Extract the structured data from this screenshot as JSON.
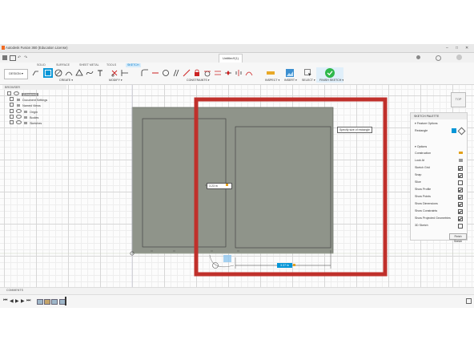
{
  "window": {
    "title": "Autodesk Fusion 360 (Education License)",
    "controls": [
      "–",
      "□",
      "✕"
    ]
  },
  "document": {
    "tab_title": "Untitled*(1)"
  },
  "toolbar": {
    "workspace_tabs": [
      "SOLID",
      "SURFACE",
      "SHEET METAL",
      "TOOLS",
      "SKETCH"
    ],
    "active_tab": "SKETCH",
    "design_label": "DESIGN ▾",
    "groups": [
      "CREATE ▾",
      "MODIFY ▾",
      "CONSTRAINTS ▾",
      "INSPECT ▾",
      "INSERT ▾",
      "SELECT ▾",
      "FINISH SKETCH ▾"
    ]
  },
  "browser": {
    "header": "BROWSER",
    "root": "(Unsaved)",
    "items": [
      "Document Settings",
      "Named Views",
      "Origin",
      "Bodies",
      "Sketches"
    ]
  },
  "canvas": {
    "tooltip": "Specify size of rectangle",
    "dimension_vertical": "3.23 in",
    "dimension_horizontal": "3.37 in",
    "view_cube_label": "TOP"
  },
  "sketch_palette": {
    "title": "SKETCH PALETTE",
    "feature_options_label": "Feature Options",
    "rectangle_label": "Rectangle",
    "options_label": "Options",
    "options": [
      {
        "label": "Construction",
        "checked": false
      },
      {
        "label": "Look At",
        "checked": false
      },
      {
        "label": "Sketch Grid",
        "checked": true
      },
      {
        "label": "Snap",
        "checked": true
      },
      {
        "label": "Slice",
        "checked": false
      },
      {
        "label": "Show Profile",
        "checked": true
      },
      {
        "label": "Show Points",
        "checked": true
      },
      {
        "label": "Show Dimensions",
        "checked": true
      },
      {
        "label": "Show Constraints",
        "checked": true
      },
      {
        "label": "Show Projected Geometries",
        "checked": true
      },
      {
        "label": "3D Sketch",
        "checked": false
      }
    ],
    "finish_button": "Finish Sketch"
  },
  "comments": {
    "label": "COMMENTS"
  },
  "colors": {
    "accent": "#0696d7",
    "highlight_frame": "#c0302b",
    "sketch_fill": "#8f948a",
    "finish_green": "#2eb84b"
  }
}
